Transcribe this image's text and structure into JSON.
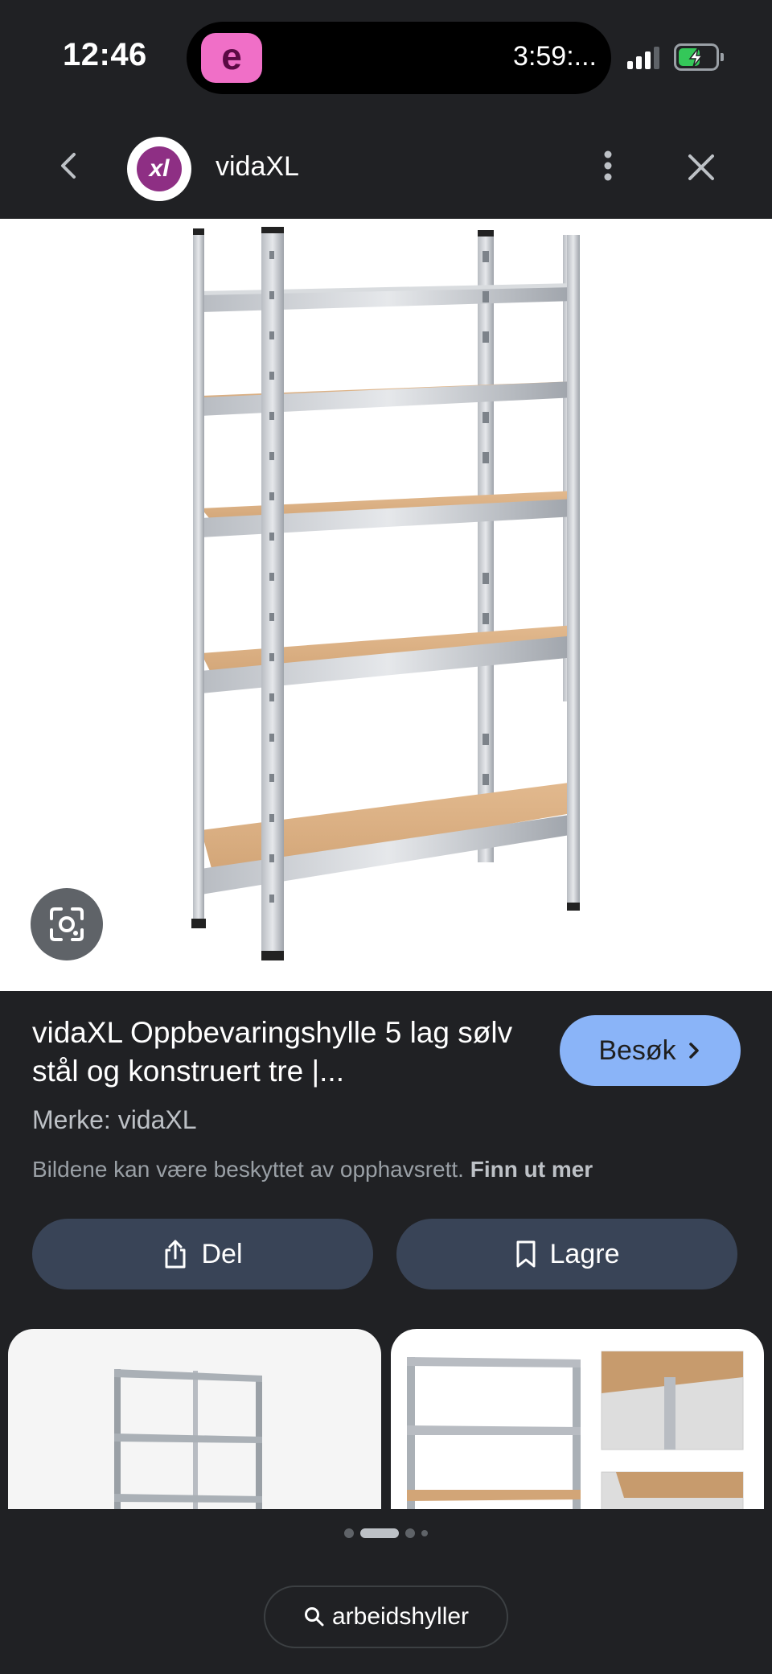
{
  "status_bar": {
    "time": "12:46",
    "island_app_letter": "e",
    "island_timer": "3:59:...",
    "battery_level": 0.6
  },
  "header": {
    "site_name": "vidaXL",
    "logo_text": "xl"
  },
  "product": {
    "title": "vidaXL Oppbevaringshylle 5 lag sølv stål og konstruert tre |...",
    "visit_label": "Besøk",
    "brand": "Merke: vidaXL",
    "copyright_text": "Bildene kan være beskyttet av opphavsrett.",
    "copyright_link": "Finn ut mer"
  },
  "actions": {
    "share_label": "Del",
    "save_label": "Lagre"
  },
  "pager": {
    "pages": 4,
    "active_index": 1
  },
  "search": {
    "query": "arbeidshyller"
  },
  "colors": {
    "background": "#202124",
    "accent": "#8ab4f8",
    "action_button": "#394457",
    "brand_purple": "#8e2f84"
  }
}
